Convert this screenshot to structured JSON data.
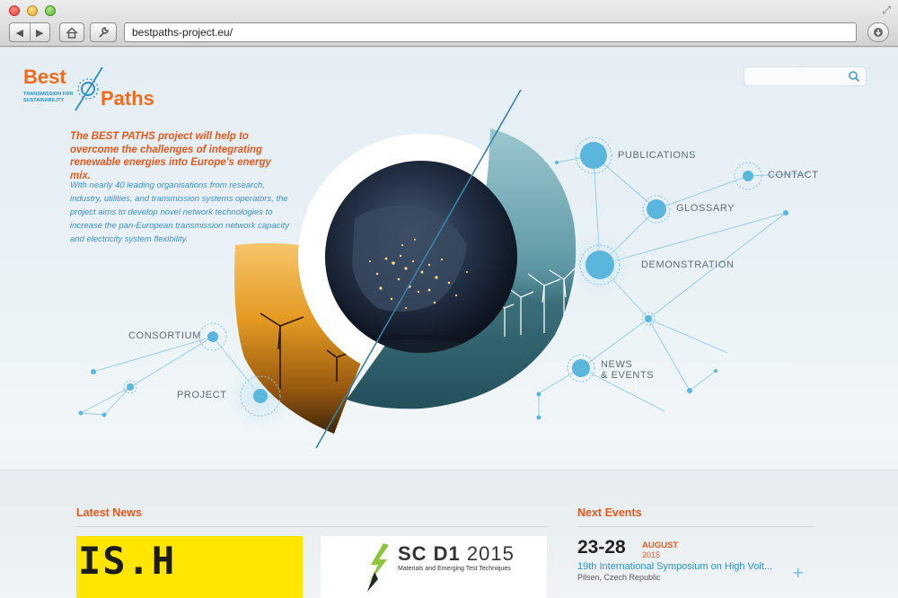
{
  "browser": {
    "url": "bestpaths-project.eu/",
    "back_glyph": "◀",
    "forward_glyph": "▶"
  },
  "logo": {
    "word1": "Best",
    "word2": "Paths",
    "tagline_line1": "TRANSMISSION FOR",
    "tagline_line2": "SUSTAINABILITY"
  },
  "hero": {
    "headline": "The BEST PATHS project will help to overcome the challenges of integrating renewable energies into Europe's energy mix.",
    "intro": "With nearly 40 leading organisations from research, industry, utilities, and transmission systems operators, the project aims to develop novel network technologies to increase the pan-European transmission network capacity and electricity system flexibility."
  },
  "search": {
    "placeholder": ""
  },
  "nav": {
    "publications": "PUBLICATIONS",
    "contact": "CONTACT",
    "glossary": "GLOSSARY",
    "demonstration": "DEMONSTRATION",
    "news_line1": "NEWS",
    "news_line2": "& EVENTS",
    "consortium": "CONSORTIUM",
    "project": "PROJECT"
  },
  "latest_news": {
    "title": "Latest News",
    "card1_text": "IS.H",
    "card2_title_bold": "SC D1",
    "card2_title_year": " 2015",
    "card2_subtitle": "Materials and Emerging Test Techniques"
  },
  "next_events": {
    "title": "Next Events",
    "days": "23-28",
    "month": "AUGUST",
    "year": "2015",
    "name": "19th International Symposium on High Volt...",
    "place": "Pilsen, Czech Republic",
    "more_glyph": "+"
  },
  "colors": {
    "accent_orange": "#e4581c",
    "accent_blue": "#2f8fc4",
    "node_blue": "#5ab6dc"
  }
}
